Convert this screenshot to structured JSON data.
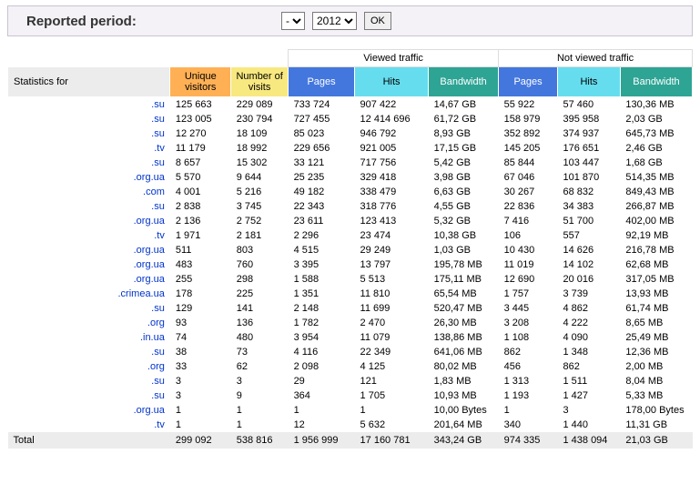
{
  "period": {
    "label": "Reported period:",
    "month_selected": "-",
    "year_selected": "2012",
    "ok_label": "OK"
  },
  "header": {
    "viewed": "Viewed traffic",
    "not_viewed": "Not viewed traffic",
    "stats_for": "Statistics for",
    "uv": "Unique visitors",
    "nv": "Number of visits",
    "pages": "Pages",
    "hits": "Hits",
    "bw": "Bandwidth"
  },
  "rows": [
    {
      "d": ".su",
      "uv": "125 663",
      "nv": "229 089",
      "p": "733 724",
      "h": "907 422",
      "b": "14,67 GB",
      "p2": "55 922",
      "h2": "57 460",
      "b2": "130,36 MB"
    },
    {
      "d": ".su",
      "uv": "123 005",
      "nv": "230 794",
      "p": "727 455",
      "h": "12 414 696",
      "b": "61,72 GB",
      "p2": "158 979",
      "h2": "395 958",
      "b2": "2,03 GB"
    },
    {
      "d": ".su",
      "uv": "12 270",
      "nv": "18 109",
      "p": "85 023",
      "h": "946 792",
      "b": "8,93 GB",
      "p2": "352 892",
      "h2": "374 937",
      "b2": "645,73 MB"
    },
    {
      "d": ".tv",
      "uv": "11 179",
      "nv": "18 992",
      "p": "229 656",
      "h": "921 005",
      "b": "17,15 GB",
      "p2": "145 205",
      "h2": "176 651",
      "b2": "2,46 GB"
    },
    {
      "d": ".su",
      "uv": "8 657",
      "nv": "15 302",
      "p": "33 121",
      "h": "717 756",
      "b": "5,42 GB",
      "p2": "85 844",
      "h2": "103 447",
      "b2": "1,68 GB"
    },
    {
      "d": ".org.ua",
      "uv": "5 570",
      "nv": "9 644",
      "p": "25 235",
      "h": "329 418",
      "b": "3,98 GB",
      "p2": "67 046",
      "h2": "101 870",
      "b2": "514,35 MB"
    },
    {
      "d": ".com",
      "uv": "4 001",
      "nv": "5 216",
      "p": "49 182",
      "h": "338 479",
      "b": "6,63 GB",
      "p2": "30 267",
      "h2": "68 832",
      "b2": "849,43 MB"
    },
    {
      "d": ".su",
      "uv": "2 838",
      "nv": "3 745",
      "p": "22 343",
      "h": "318 776",
      "b": "4,55 GB",
      "p2": "22 836",
      "h2": "34 383",
      "b2": "266,87 MB"
    },
    {
      "d": ".org.ua",
      "uv": "2 136",
      "nv": "2 752",
      "p": "23 611",
      "h": "123 413",
      "b": "5,32 GB",
      "p2": "7 416",
      "h2": "51 700",
      "b2": "402,00 MB"
    },
    {
      "d": ".tv",
      "uv": "1 971",
      "nv": "2 181",
      "p": "2 296",
      "h": "23 474",
      "b": "10,38 GB",
      "p2": "106",
      "h2": "557",
      "b2": "92,19 MB"
    },
    {
      "d": ".org.ua",
      "uv": "511",
      "nv": "803",
      "p": "4 515",
      "h": "29 249",
      "b": "1,03 GB",
      "p2": "10 430",
      "h2": "14 626",
      "b2": "216,78 MB"
    },
    {
      "d": ".org.ua",
      "uv": "483",
      "nv": "760",
      "p": "3 395",
      "h": "13 797",
      "b": "195,78 MB",
      "p2": "11 019",
      "h2": "14 102",
      "b2": "62,68 MB"
    },
    {
      "d": ".org.ua",
      "uv": "255",
      "nv": "298",
      "p": "1 588",
      "h": "5 513",
      "b": "175,11 MB",
      "p2": "12 690",
      "h2": "20 016",
      "b2": "317,05 MB"
    },
    {
      "d": ".crimea.ua",
      "uv": "178",
      "nv": "225",
      "p": "1 351",
      "h": "11 810",
      "b": "65,54 MB",
      "p2": "1 757",
      "h2": "3 739",
      "b2": "13,93 MB"
    },
    {
      "d": ".su",
      "uv": "129",
      "nv": "141",
      "p": "2 148",
      "h": "11 699",
      "b": "520,47 MB",
      "p2": "3 445",
      "h2": "4 862",
      "b2": "61,74 MB"
    },
    {
      "d": ".org",
      "uv": "93",
      "nv": "136",
      "p": "1 782",
      "h": "2 470",
      "b": "26,30 MB",
      "p2": "3 208",
      "h2": "4 222",
      "b2": "8,65 MB"
    },
    {
      "d": ".in.ua",
      "uv": "74",
      "nv": "480",
      "p": "3 954",
      "h": "11 079",
      "b": "138,86 MB",
      "p2": "1 108",
      "h2": "4 090",
      "b2": "25,49 MB"
    },
    {
      "d": ".su",
      "uv": "38",
      "nv": "73",
      "p": "4 116",
      "h": "22 349",
      "b": "641,06 MB",
      "p2": "862",
      "h2": "1 348",
      "b2": "12,36 MB"
    },
    {
      "d": ".org",
      "uv": "33",
      "nv": "62",
      "p": "2 098",
      "h": "4 125",
      "b": "80,02 MB",
      "p2": "456",
      "h2": "862",
      "b2": "2,00 MB"
    },
    {
      "d": ".su",
      "uv": "3",
      "nv": "3",
      "p": "29",
      "h": "121",
      "b": "1,83 MB",
      "p2": "1 313",
      "h2": "1 511",
      "b2": "8,04 MB"
    },
    {
      "d": ".su",
      "uv": "3",
      "nv": "9",
      "p": "364",
      "h": "1 705",
      "b": "10,93 MB",
      "p2": "1 193",
      "h2": "1 427",
      "b2": "5,33 MB"
    },
    {
      "d": ".org.ua",
      "uv": "1",
      "nv": "1",
      "p": "1",
      "h": "1",
      "b": "10,00 Bytes",
      "p2": "1",
      "h2": "3",
      "b2": "178,00 Bytes"
    },
    {
      "d": ".tv",
      "uv": "1",
      "nv": "1",
      "p": "12",
      "h": "5 632",
      "b": "201,64 MB",
      "p2": "340",
      "h2": "1 440",
      "b2": "11,31 GB"
    }
  ],
  "total": {
    "label": "Total",
    "uv": "299 092",
    "nv": "538 816",
    "p": "1 956 999",
    "h": "17 160 781",
    "b": "343,24 GB",
    "p2": "974 335",
    "h2": "1 438 094",
    "b2": "21,03 GB"
  }
}
